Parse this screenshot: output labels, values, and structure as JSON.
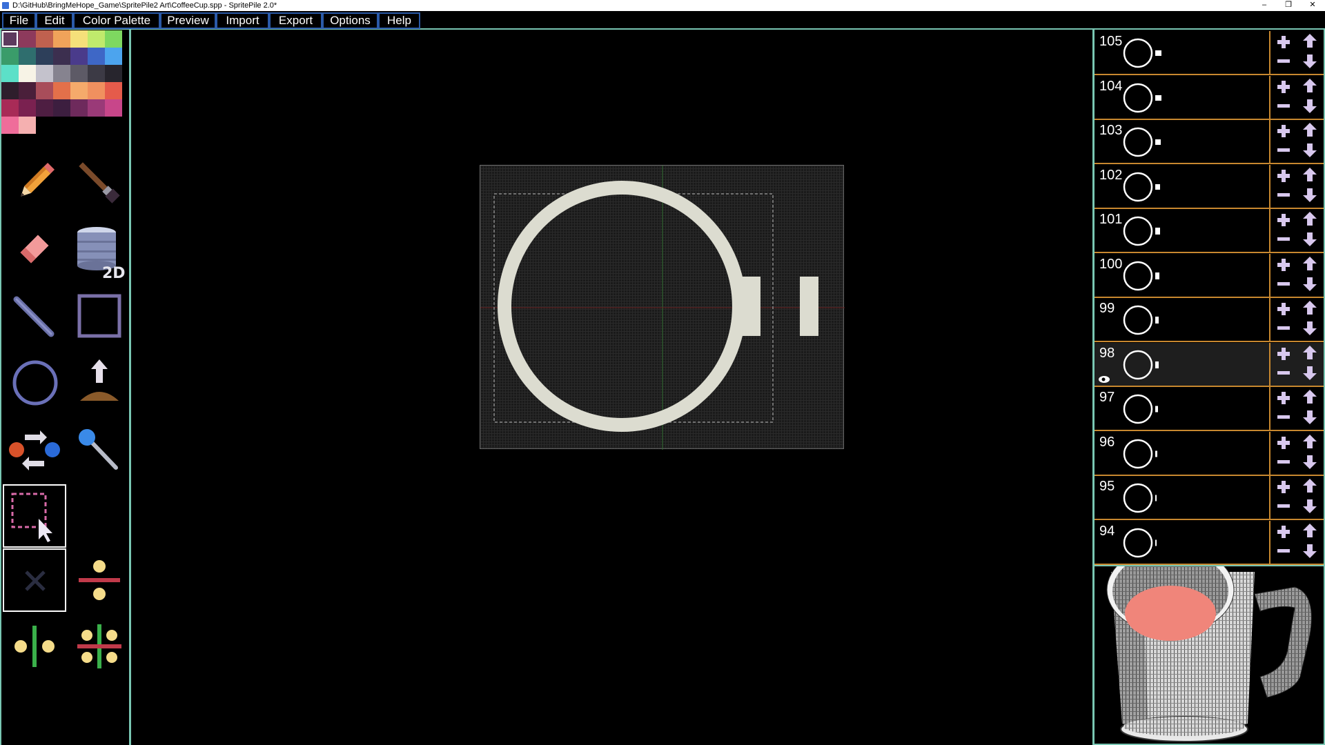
{
  "window": {
    "title": "D:\\GitHub\\BringMeHope_Game\\SpritePile2 Art\\CoffeeCup.spp - SpritePile 2.0*",
    "minimize": "–",
    "restore": "❐",
    "close": "✕"
  },
  "menu": {
    "items": [
      {
        "label": "File"
      },
      {
        "label": "Edit"
      },
      {
        "label": "Color Palette"
      },
      {
        "label": "Preview"
      },
      {
        "label": "Import"
      },
      {
        "label": "Export"
      },
      {
        "label": "Options"
      },
      {
        "label": "Help"
      }
    ]
  },
  "palette": {
    "selected_color": "#5d3a5e",
    "colors": [
      "#5d3a5e",
      "#8d3a5c",
      "#c0614f",
      "#f0a35a",
      "#f5e07a",
      "#c0ea6c",
      "#7ed860",
      "#3a9c6a",
      "#2f6e6e",
      "#2d3f5a",
      "#3c2f4f",
      "#4a3b8b",
      "#3e67c6",
      "#4ca4ee",
      "#5ce0c8",
      "#f7f3e6",
      "#c4c2cc",
      "#86838f",
      "#5d5a66",
      "#3c3a45",
      "#27252d",
      "#2e1e2c",
      "#4a1f3a",
      "#a84d5a",
      "#e3704a",
      "#f5aa6b",
      "#f0905f",
      "#e55b4b",
      "#a82b57",
      "#7a2150",
      "#4e1e42",
      "#3c1e3f",
      "#6e2a5c",
      "#9a3a78",
      "#c8468a",
      "#ef6d9a",
      "#f5b0b0"
    ]
  },
  "tools": {
    "items": [
      {
        "icon": "pencil-icon"
      },
      {
        "icon": "brush-icon"
      },
      {
        "icon": "eraser-icon"
      },
      {
        "icon": "bucket-2d-icon",
        "badge": "2D"
      },
      {
        "icon": "line-icon"
      },
      {
        "icon": "rectangle-icon"
      },
      {
        "icon": "ellipse-icon"
      },
      {
        "icon": "extrude-icon"
      },
      {
        "icon": "swap-colors-icon"
      },
      {
        "icon": "eyedropper-icon"
      },
      {
        "icon": "select-icon"
      },
      {
        "icon": "clear-selection-icon"
      },
      {
        "icon": "mirror-horizontal-icon"
      },
      {
        "icon": "mirror-vertical-icon"
      },
      {
        "icon": "mirror-both-icon"
      }
    ]
  },
  "layers": {
    "current": "98",
    "items": [
      {
        "num": "105"
      },
      {
        "num": "104"
      },
      {
        "num": "103"
      },
      {
        "num": "102"
      },
      {
        "num": "101"
      },
      {
        "num": "100"
      },
      {
        "num": "99"
      },
      {
        "num": "98"
      },
      {
        "num": "97"
      },
      {
        "num": "96"
      },
      {
        "num": "95"
      },
      {
        "num": "94"
      }
    ]
  },
  "colors": {
    "border": "#79c7b3",
    "layer_border": "#c8882f",
    "control_icon": "#d8c8ee",
    "menu_border": "#2b5aa8",
    "cup_liquid": "#f0857a"
  }
}
